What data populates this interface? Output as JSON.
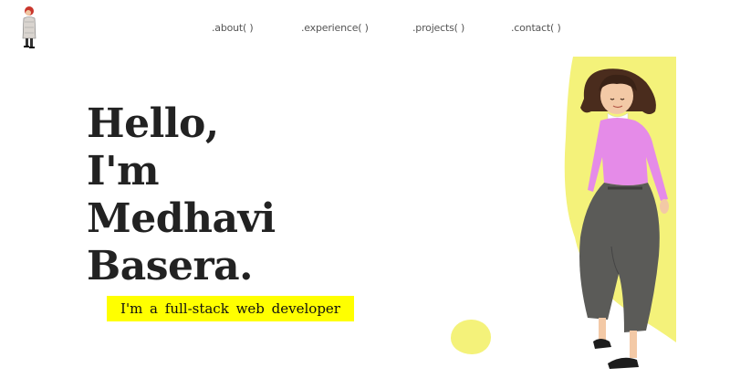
{
  "nav": {
    "items": [
      {
        "label": ".about( )"
      },
      {
        "label": ".experience( )"
      },
      {
        "label": ".projects( )"
      },
      {
        "label": ".contact( )"
      }
    ]
  },
  "hero": {
    "title_lines": [
      "Hello,",
      "I'm",
      "Medhavi",
      "Basera."
    ],
    "subtitle": "I'm a full-stack web developer"
  },
  "colors": {
    "accent_yellow": "#ffff00",
    "blob_yellow": "#f4f27a",
    "text_dark": "#222222",
    "sweater_pink": "#e58be8",
    "pants_gray": "#5b5b58"
  },
  "icons": {
    "logo": "person-avatar-icon",
    "illustration": "woman-character-illustration"
  }
}
